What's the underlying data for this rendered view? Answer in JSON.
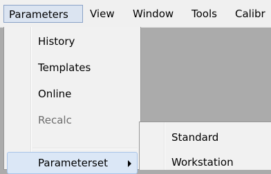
{
  "menubar": {
    "items": [
      "Parameters",
      "View",
      "Window",
      "Tools",
      "Calibr"
    ]
  },
  "parameters_menu": {
    "items": [
      "History",
      "Templates",
      "Online",
      "Recalc"
    ],
    "submenu_item": "Parameterset"
  },
  "parameterset_submenu": {
    "items": [
      "Standard",
      "Workstation"
    ]
  },
  "colors": {
    "workspace": "#ababab",
    "menu_background": "#f1f1f1",
    "highlight": "#dbe7f6",
    "disabled_text": "#6d6d6d"
  }
}
